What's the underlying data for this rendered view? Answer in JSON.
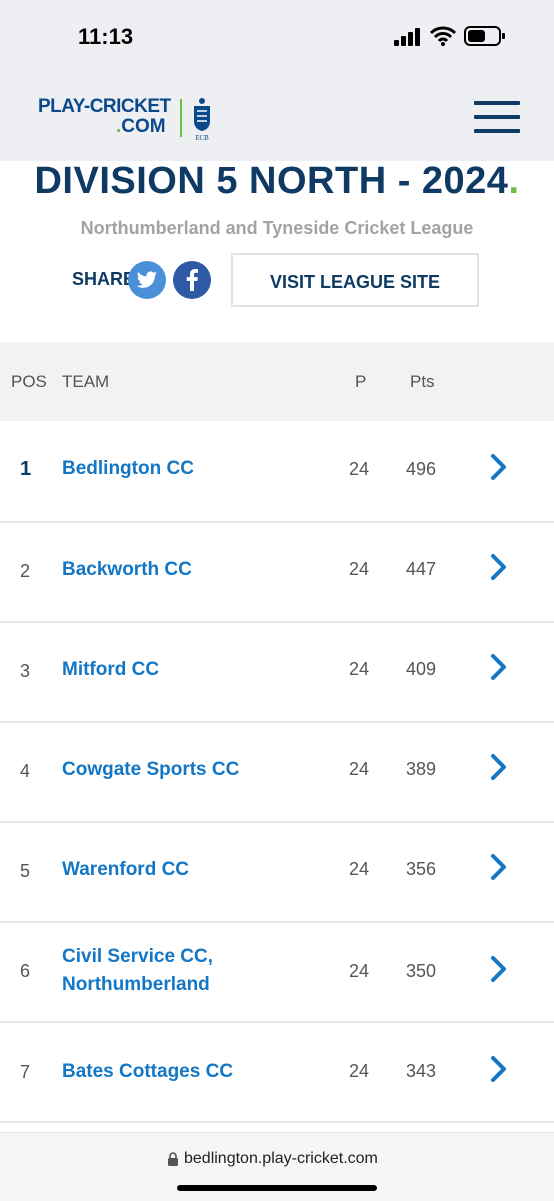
{
  "status_bar": {
    "time": "11:13"
  },
  "header": {
    "logo_line1": "PLAY-CRICKET",
    "logo_line2": "COM",
    "badge_text": "ECB",
    "menu_icon": "hamburger-menu-icon"
  },
  "league": {
    "title": "DIVISION 5 NORTH - 2024",
    "subtitle": "Northumberland and Tyneside Cricket League",
    "share_label": "SHARE",
    "visit_button": "VISIT LEAGUE SITE"
  },
  "table": {
    "headers": {
      "pos": "POS",
      "team": "TEAM",
      "p": "P",
      "pts": "Pts"
    },
    "rows": [
      {
        "pos": "1",
        "team": "Bedlington CC",
        "team_line2": "",
        "p": "24",
        "pts": "496"
      },
      {
        "pos": "2",
        "team": "Backworth CC",
        "team_line2": "",
        "p": "24",
        "pts": "447"
      },
      {
        "pos": "3",
        "team": "Mitford CC",
        "team_line2": "",
        "p": "24",
        "pts": "409"
      },
      {
        "pos": "4",
        "team": "Cowgate Sports CC",
        "team_line2": "",
        "p": "24",
        "pts": "389"
      },
      {
        "pos": "5",
        "team": "Warenford CC",
        "team_line2": "",
        "p": "24",
        "pts": "356"
      },
      {
        "pos": "6",
        "team": "Civil Service CC,",
        "team_line2": "Northumberland",
        "p": "24",
        "pts": "350"
      },
      {
        "pos": "7",
        "team": "Bates Cottages CC",
        "team_line2": "",
        "p": "24",
        "pts": "343"
      }
    ]
  },
  "browser": {
    "url": "bedlington.play-cricket.com"
  },
  "colors": {
    "navy": "#0e3a63",
    "link_blue": "#1377c6",
    "green": "#6cbe45"
  }
}
